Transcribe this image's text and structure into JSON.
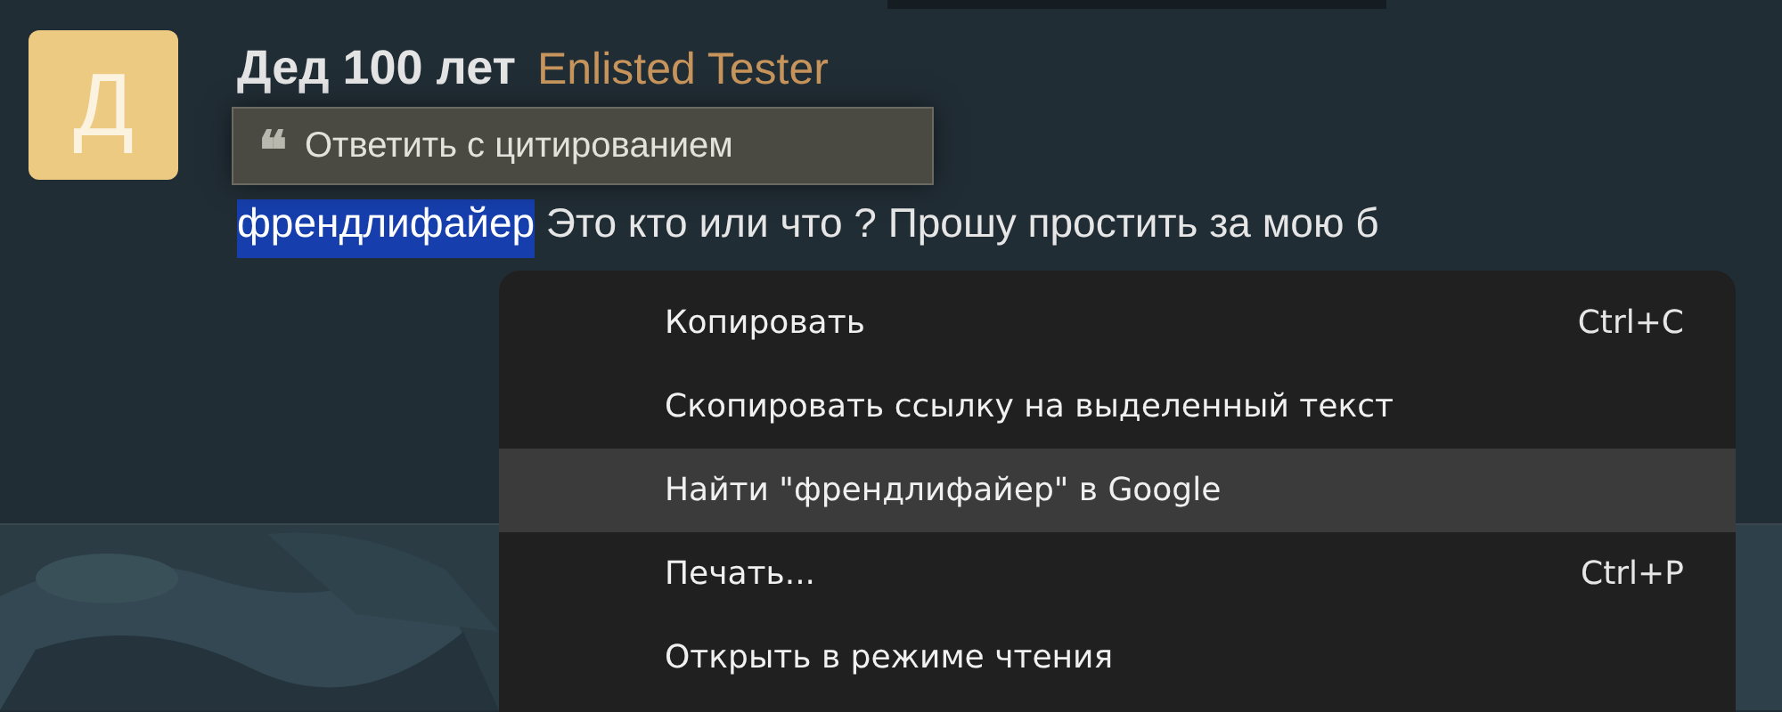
{
  "post": {
    "avatar_letter": "Д",
    "author": "Дед 100 лет",
    "role": "Enlisted Tester",
    "selected_word": "френдлифайер",
    "text": " Это кто или что ? Прошу простить за мою б"
  },
  "quote_popup": {
    "icon": "❝",
    "label": "Ответить с цитированием"
  },
  "context_menu": {
    "items": [
      {
        "label": "Копировать",
        "shortcut": "Ctrl+C",
        "selected": false
      },
      {
        "label": "Скопировать ссылку на выделенный текст",
        "selected": false
      },
      {
        "label": "Найти \"френдлифайер\" в Google",
        "selected": true
      },
      {
        "label": "Печать...",
        "shortcut": "Ctrl+P",
        "selected": false
      },
      {
        "label": "Открыть в режиме чтения",
        "selected": false
      }
    ]
  }
}
